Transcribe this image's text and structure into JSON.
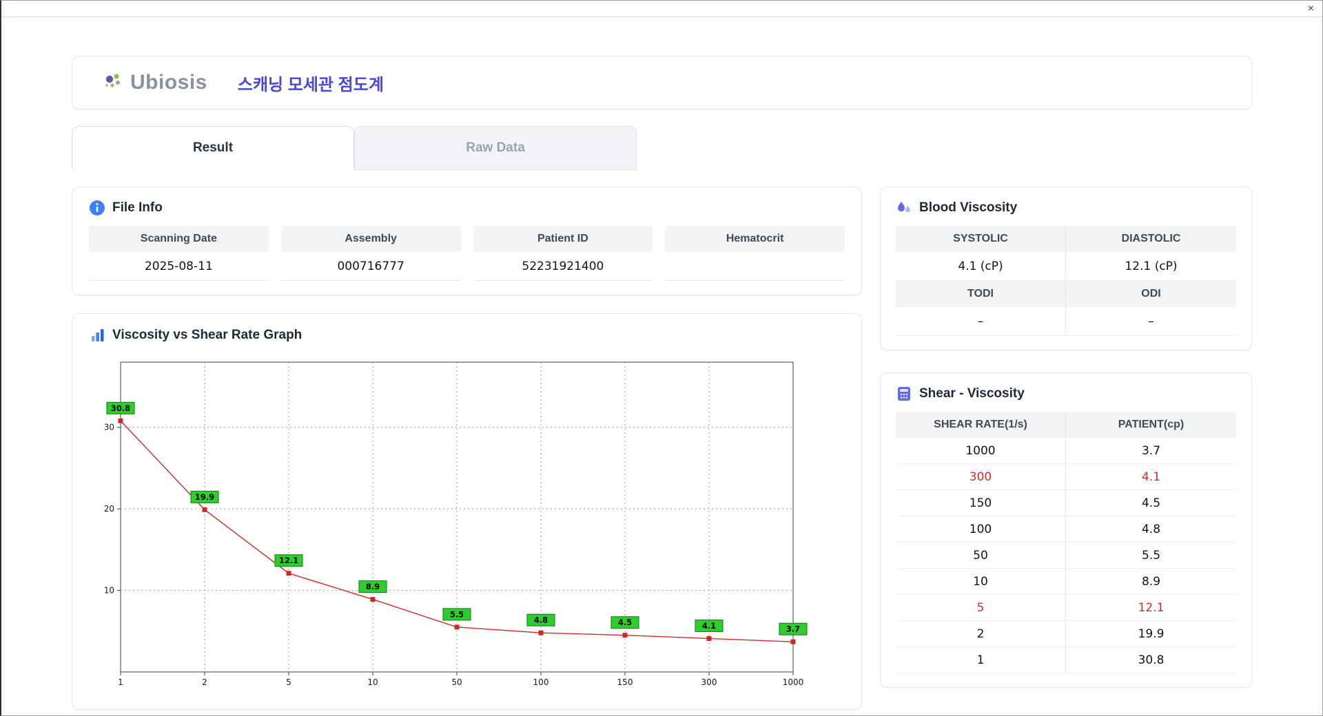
{
  "window": {
    "close_glyph": "×"
  },
  "header": {
    "logo_text": "Ubiosis",
    "app_title": "스캐닝 모세관 점도계"
  },
  "tabs": [
    {
      "label": "Result",
      "active": true
    },
    {
      "label": "Raw Data",
      "active": false
    }
  ],
  "file_info": {
    "title": "File Info",
    "fields": [
      {
        "label": "Scanning Date",
        "value": "2025-08-11"
      },
      {
        "label": "Assembly",
        "value": "000716777"
      },
      {
        "label": "Patient ID",
        "value": "52231921400"
      },
      {
        "label": "Hematocrit",
        "value": ""
      }
    ]
  },
  "blood_viscosity": {
    "title": "Blood Viscosity",
    "row1": {
      "h1": "SYSTOLIC",
      "h2": "DIASTOLIC",
      "v1": "4.1 (cP)",
      "v2": "12.1 (cP)"
    },
    "row2": {
      "h1": "TODI",
      "h2": "ODI",
      "v1": "–",
      "v2": "–"
    }
  },
  "graph": {
    "title": "Viscosity vs Shear Rate Graph"
  },
  "chart_data": {
    "type": "line",
    "title": "Viscosity vs Shear Rate Graph",
    "x": [
      1,
      2,
      5,
      10,
      50,
      100,
      150,
      300,
      1000
    ],
    "x_scale": "categorical-even-spacing",
    "values": [
      30.8,
      19.9,
      12.1,
      8.9,
      5.5,
      4.8,
      4.5,
      4.1,
      3.7
    ],
    "labels": [
      "30.8",
      "19.9",
      "12.1",
      "8.9",
      "5.5",
      "4.8",
      "4.5",
      "4.1",
      "3.7"
    ],
    "xlabel": "",
    "ylabel": "",
    "y_ticks": [
      10,
      20,
      30
    ],
    "ylim": [
      0,
      38
    ],
    "grid": "dashed",
    "legend": "none",
    "line_color": "#cc2a2a",
    "marker": "square",
    "label_bg": "#2ecc2e",
    "label_border": "#0f7a0f"
  },
  "shear_table": {
    "title": "Shear - Viscosity",
    "columns": [
      "SHEAR RATE(1/s)",
      "PATIENT(cp)"
    ],
    "rows": [
      {
        "shear": "1000",
        "patient": "3.7",
        "highlight": false
      },
      {
        "shear": "300",
        "patient": "4.1",
        "highlight": true
      },
      {
        "shear": "150",
        "patient": "4.5",
        "highlight": false
      },
      {
        "shear": "100",
        "patient": "4.8",
        "highlight": false
      },
      {
        "shear": "50",
        "patient": "5.5",
        "highlight": false
      },
      {
        "shear": "10",
        "patient": "8.9",
        "highlight": false
      },
      {
        "shear": "5",
        "patient": "12.1",
        "highlight": true
      },
      {
        "shear": "2",
        "patient": "19.9",
        "highlight": false
      },
      {
        "shear": "1",
        "patient": "30.8",
        "highlight": false
      }
    ],
    "highlight_color": "#d42b2b"
  }
}
